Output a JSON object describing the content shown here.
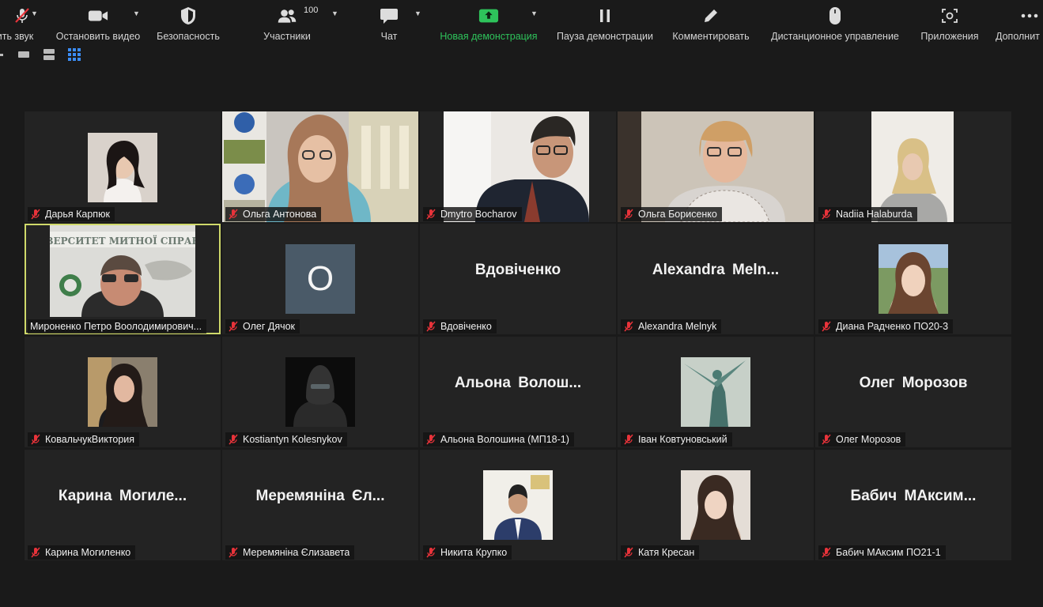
{
  "toolbar": {
    "mute": {
      "label": "ить звук"
    },
    "video": {
      "label": "Остановить видео"
    },
    "security": {
      "label": "Безопасность"
    },
    "participants": {
      "label": "Участники",
      "count": "100"
    },
    "chat": {
      "label": "Чат"
    },
    "share": {
      "label": "Новая демонстрация"
    },
    "pause": {
      "label": "Пауза демонстрации"
    },
    "annotate": {
      "label": "Комментировать"
    },
    "remote": {
      "label": "Дистанционное управление"
    },
    "apps": {
      "label": "Приложения"
    },
    "more": {
      "label": "Дополнит"
    }
  },
  "tiles": [
    {
      "caption": "Дарья Карпюк"
    },
    {
      "caption": "Ольга Антонова"
    },
    {
      "caption": "Dmytro Bocharov"
    },
    {
      "caption": "Ольга Борисенко"
    },
    {
      "caption": "Nadiia Halaburda"
    },
    {
      "caption": "Мироненко Петро Вооло­димирович..."
    },
    {
      "caption": "Олег Дячок",
      "avatar_letter": "О"
    },
    {
      "caption": "Вдовіченко",
      "display": "Вдовіченко"
    },
    {
      "caption": "Alexandra Melnyk",
      "display": "Alexandra  Meln..."
    },
    {
      "caption": "Диана Радченко ПО20-3"
    },
    {
      "caption": "КовальчукВиктория"
    },
    {
      "caption": "Kostiantyn Kolesnykov"
    },
    {
      "caption": "Альона Волошина (МП18-1)",
      "display": "Альона  Волош..."
    },
    {
      "caption": "Іван Ковтуновський"
    },
    {
      "caption": "Олег Морозов",
      "display": "Олег  Морозов"
    },
    {
      "caption": "Карина Могиленко",
      "display": "Карина  Могиле..."
    },
    {
      "caption": "Меремяніна Єлизавета",
      "display": "Меремяніна  Єл..."
    },
    {
      "caption": "Никита Крупко"
    },
    {
      "caption": "Катя Кресан"
    },
    {
      "caption": "Бабич МАксим ПО21-1",
      "display": "Бабич  МАксим..."
    }
  ],
  "colors": {
    "share_green": "#2ec35b",
    "active_border": "#cfd96a",
    "mic_red": "#e8333a",
    "avatar_bg": "#4a5a68"
  }
}
